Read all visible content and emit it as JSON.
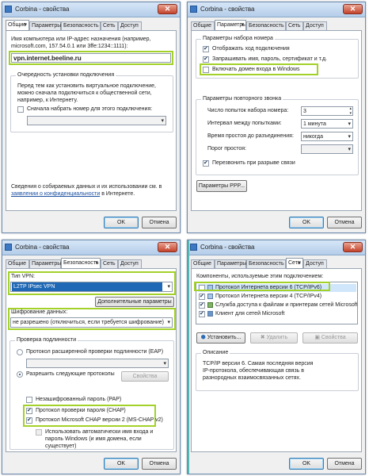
{
  "windows": [
    {
      "title": "Corbina - свойства",
      "tabs": [
        "Общие",
        "Параметры",
        "Безопасность",
        "Сеть",
        "Доступ"
      ],
      "host_label": "Имя компьютера или IP-адрес назначения (например, microsoft.com, 157.54.0.1 или 3ffe:1234::1111):",
      "host_value": "vpn.internet.beeline.ru",
      "first_connect_group": "Очередность установки подключения",
      "first_connect_desc": "Перед тем как установить виртуальное подключение, можно сначала подключиться к общественной сети, например, к Интернету.",
      "dial_first_label": "Сначала набрать номер для этого подключения:",
      "privacy_text_1": "Сведения о собираемых данных и их использовании см. в",
      "privacy_link": "заявлении о конфиденциальности",
      "privacy_text_2": "в Интернете.",
      "ok": "OK",
      "cancel": "Отмена"
    },
    {
      "title": "Corbina - свойства",
      "tabs": [
        "Общие",
        "Параметры",
        "Безопасность",
        "Сеть",
        "Доступ"
      ],
      "dial_group": "Параметры набора номера",
      "show_progress": "Отображать ход подключения",
      "save_credentials": "Запрашивать имя, пароль, сертификат и т.д.",
      "include_domain": "Включать домен входа в Windows",
      "redial_group": "Параметры повторного звонка",
      "redial_attempts_label": "Число попыток набора номера:",
      "redial_attempts_value": "3",
      "redial_interval_label": "Интервал между попытками:",
      "redial_interval_value": "1 минута",
      "idle_label": "Время простоя до разъединения:",
      "idle_value": "никогда",
      "idle_threshold_label": "Порог простоя:",
      "redial_on_drop": "Перезвонить при разрыве связи",
      "ppp_button": "Параметры PPP...",
      "ok": "OK",
      "cancel": "Отмена"
    },
    {
      "title": "Corbina - свойства",
      "tabs": [
        "Общие",
        "Параметры",
        "Безопасность",
        "Сеть",
        "Доступ"
      ],
      "vpn_type_label": "Тип VPN:",
      "vpn_type_value": "L2TP IPsec VPN",
      "advanced_button": "Дополнительные параметры",
      "encryption_label": "Шифрование данных:",
      "encryption_value": "не разрешено (отключиться, если требуется шифрование)",
      "auth_group": "Проверка подлинности",
      "eap_label": "Протокол расширенной проверки подлинности (EAP)",
      "allow_label": "Разрешить следующие протоколы",
      "properties_button": "Свойства",
      "pap_label": "Незашифрованный пароль (PAP)",
      "chap_label": "Протокол проверки пароля (CHAP)",
      "mschap_label": "Протокол Microsoft CHAP версии 2 (MS-CHAP v2)",
      "auto_logon_label": "Использовать автоматически имя входа и пароль Windows (и имя домена, если существует)",
      "ok": "OK",
      "cancel": "Отмена"
    },
    {
      "title": "Corbina - свойства",
      "tabs": [
        "Общие",
        "Параметры",
        "Безопасность",
        "Сеть",
        "Доступ"
      ],
      "components_label": "Компоненты, используемые этим подключением:",
      "components": [
        "Протокол Интернета версии 6 (TCP/IPv6)",
        "Протокол Интернета версии 4 (TCP/IPv4)",
        "Служба доступа к файлам и принтерам сетей Microsoft",
        "Клиент для сетей Microsoft"
      ],
      "install_button": "Установить...",
      "remove_button": "Удалить",
      "properties_button": "Свойства",
      "description_group": "Описание",
      "description_text": "TCP/IP версии 6. Самая последняя версия IP-протокола, обеспечивающая связь в разнородных взаимосвязанных сетях.",
      "ok": "OK",
      "cancel": "Отмена"
    }
  ]
}
